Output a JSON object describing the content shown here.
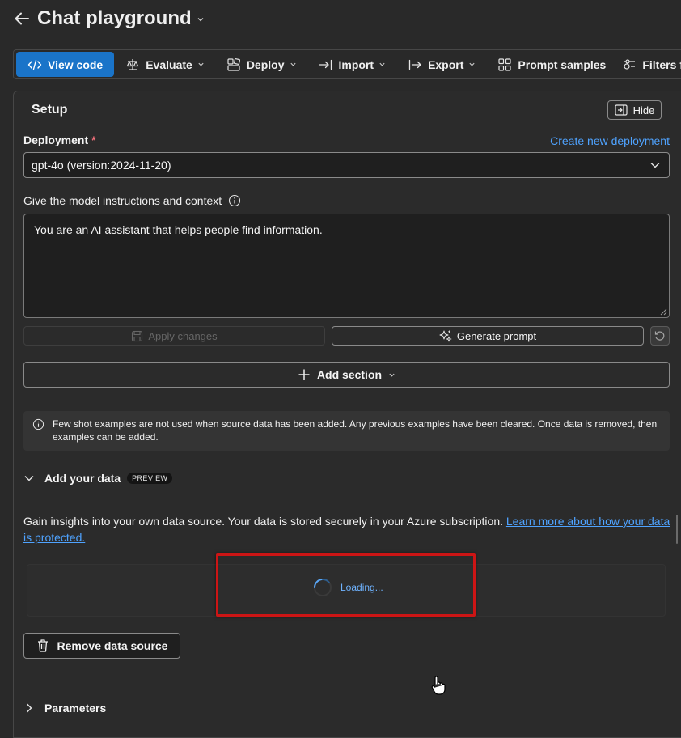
{
  "header": {
    "title": "Chat playground"
  },
  "toolbar": {
    "view_code": "View code",
    "evaluate": "Evaluate",
    "deploy": "Deploy",
    "import": "Import",
    "export": "Export",
    "prompt_samples": "Prompt samples",
    "filters": "Filters fee"
  },
  "setup": {
    "title": "Setup",
    "hide_label": "Hide",
    "deployment_label": "Deployment",
    "required_marker": "*",
    "create_link": "Create new deployment",
    "deployment_value": "gpt-4o (version:2024-11-20)",
    "instructions_label": "Give the model instructions and context",
    "instructions_value": "You are an AI assistant that helps people find information.",
    "apply_label": "Apply changes",
    "generate_label": "Generate prompt",
    "add_section_label": "Add section",
    "info_text": "Few shot examples are not used when source data has been added. Any previous examples have been cleared. Once data is removed, then examples can be added."
  },
  "add_data": {
    "title": "Add your data",
    "badge": "PREVIEW",
    "description": "Gain insights into your own data source. Your data is stored securely in your Azure subscription. ",
    "link_text": "Learn more about how your data is protected.",
    "loading_text": "Loading...",
    "remove_label": "Remove data source"
  },
  "parameters": {
    "title": "Parameters"
  },
  "colors": {
    "background": "#292929",
    "accent": "#1a74c9",
    "link": "#4fa3ff",
    "highlight": "#cc1515"
  }
}
